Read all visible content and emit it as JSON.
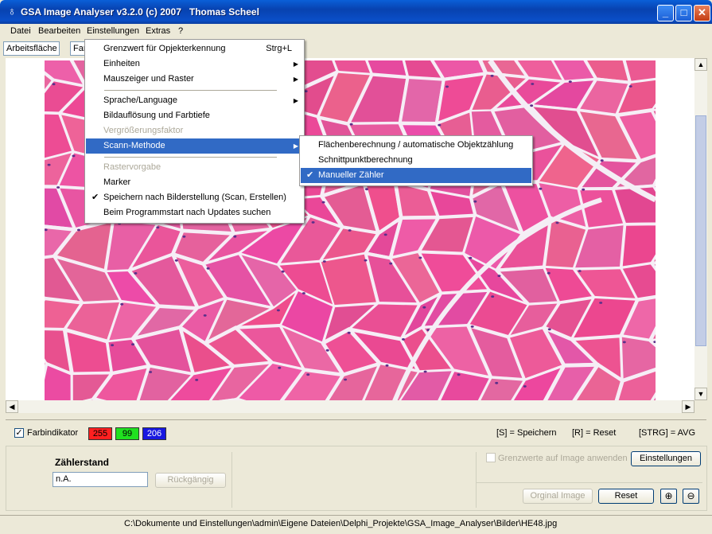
{
  "window": {
    "title": "GSA Image Analyser v3.2.0 (c) 2007   Thomas Scheel",
    "controls": {
      "minimize": "_",
      "maximize": "□",
      "close": "✕"
    }
  },
  "menubar": [
    {
      "label": "Datei"
    },
    {
      "label": "Bearbeiten"
    },
    {
      "label": "Einstellungen"
    },
    {
      "label": "Extras"
    },
    {
      "label": "?"
    }
  ],
  "toolbar": {
    "workspace_tab": "Arbeitsfläche",
    "second_tab": "Far"
  },
  "settings_menu": {
    "items": [
      {
        "label": "Grenzwert für Opjekterkennung",
        "shortcut": "Strg+L"
      },
      {
        "label": "Einheiten",
        "submenu": true
      },
      {
        "label": "Mauszeiger und Raster",
        "submenu": true
      },
      {
        "label": "Sprache/Language",
        "submenu": true
      },
      {
        "label": "Bildauflösung und Farbtiefe"
      },
      {
        "label": "Vergrößerungsfaktor",
        "disabled": true
      },
      {
        "label": "Scann-Methode",
        "submenu": true,
        "highlighted": true
      },
      {
        "label": "Rastervorgabe",
        "disabled": true
      },
      {
        "label": "Marker"
      },
      {
        "label": "Speichern nach Bilderstellung (Scan, Erstellen)",
        "checked": true
      },
      {
        "label": "Beim Programmstart nach Updates suchen"
      }
    ]
  },
  "scan_submenu": {
    "items": [
      {
        "label": "Flächenberechnung / automatische Objektzählung"
      },
      {
        "label": "Schnittpunktberechnung"
      },
      {
        "label": "Manueller Zähler",
        "checked": true,
        "highlighted": true
      }
    ]
  },
  "color_indicator": {
    "label": "Farbindikator",
    "checked": true,
    "r": "255",
    "g": "99",
    "b": "206",
    "colors": {
      "r": "#ff2020",
      "g": "#20e020",
      "b": "#1818e0"
    }
  },
  "shortcuts": {
    "save": "[S] = Speichern",
    "reset": "[R] = Reset",
    "avg": "[STRG] = AVG"
  },
  "counter": {
    "title": "Zählerstand",
    "value": "n.A.",
    "undo_button": "Rückgängig"
  },
  "threshold": {
    "checkbox_label": "Grenzwerte auf Image anwenden",
    "settings_button": "Einstellungen"
  },
  "bottom_buttons": {
    "original_image": "Orginal Image",
    "reset": "Reset"
  },
  "status_path": "C:\\Dokumente und Einstellungen\\admin\\Eigene Dateien\\Delphi_Projekte\\GSA_Image_Analyser\\Bilder\\HE48.jpg",
  "icons": [
    "app-icon",
    "minimize-icon",
    "maximize-icon",
    "close-icon",
    "zoom-in-icon",
    "zoom-out-icon",
    "submenu-arrow-icon",
    "check-icon"
  ],
  "accent_colors": {
    "titlebar": "#0842b0",
    "menu_highlight": "#316ac5",
    "tissue_pink": "#e9669f",
    "cell_border": "#f4f0f6"
  }
}
